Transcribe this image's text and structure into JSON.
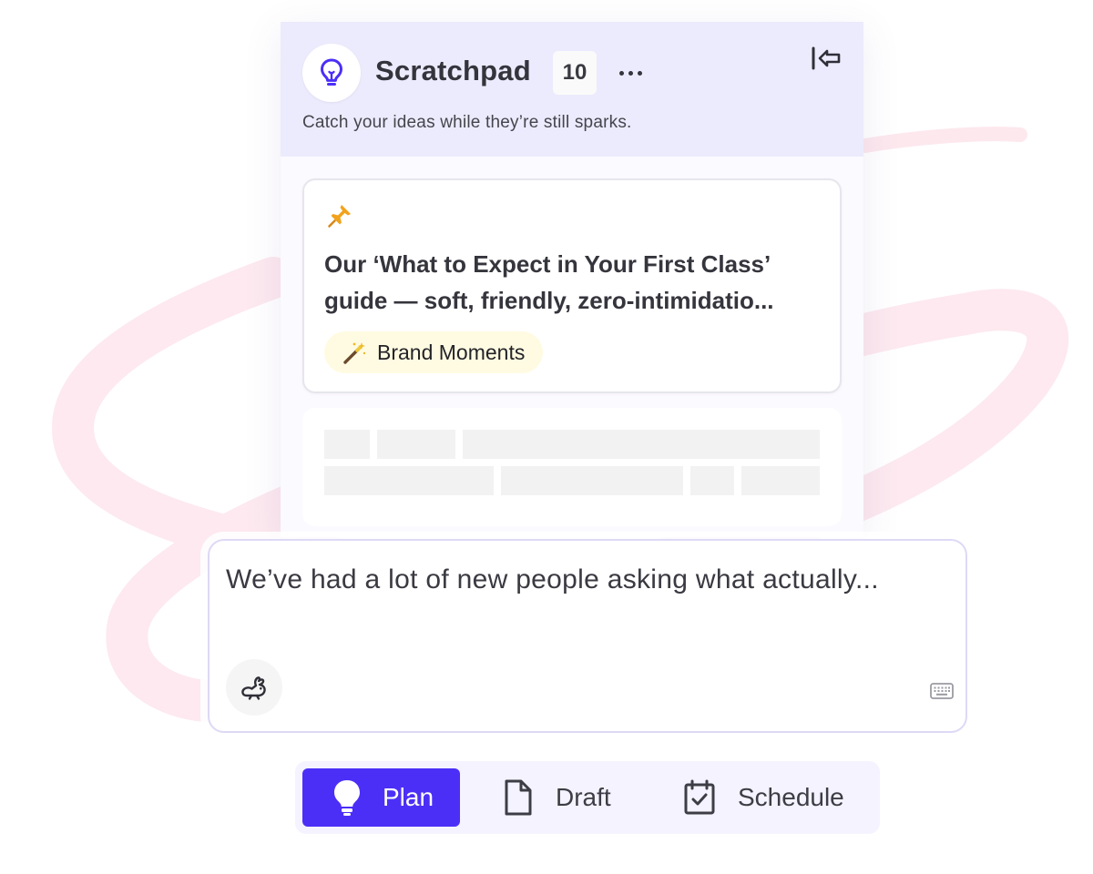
{
  "scratchpad": {
    "title": "Scratchpad",
    "count": "10",
    "subtitle": "Catch your ideas while they’re still sparks.",
    "note": {
      "line1": "Our ‘What to Expect in Your First Class’",
      "line2": "guide — soft, friendly, zero-intimidatio...",
      "tag": "Brand Moments",
      "pin_icon": "pushpin-icon",
      "tag_icon": "magic-wand-icon"
    }
  },
  "composer": {
    "text": "We’ve had a lot of new people asking what actually..."
  },
  "modes": [
    {
      "label": "Plan",
      "icon": "lightbulb-icon",
      "active": true
    },
    {
      "label": "Draft",
      "icon": "document-icon",
      "active": false
    },
    {
      "label": "Schedule",
      "icon": "calendar-check-icon",
      "active": false
    }
  ],
  "colors": {
    "accent": "#4b2ff7",
    "header_bg": "#ecebfd",
    "tag_bg": "#fffbe2",
    "scribble": "#fde8ee"
  }
}
